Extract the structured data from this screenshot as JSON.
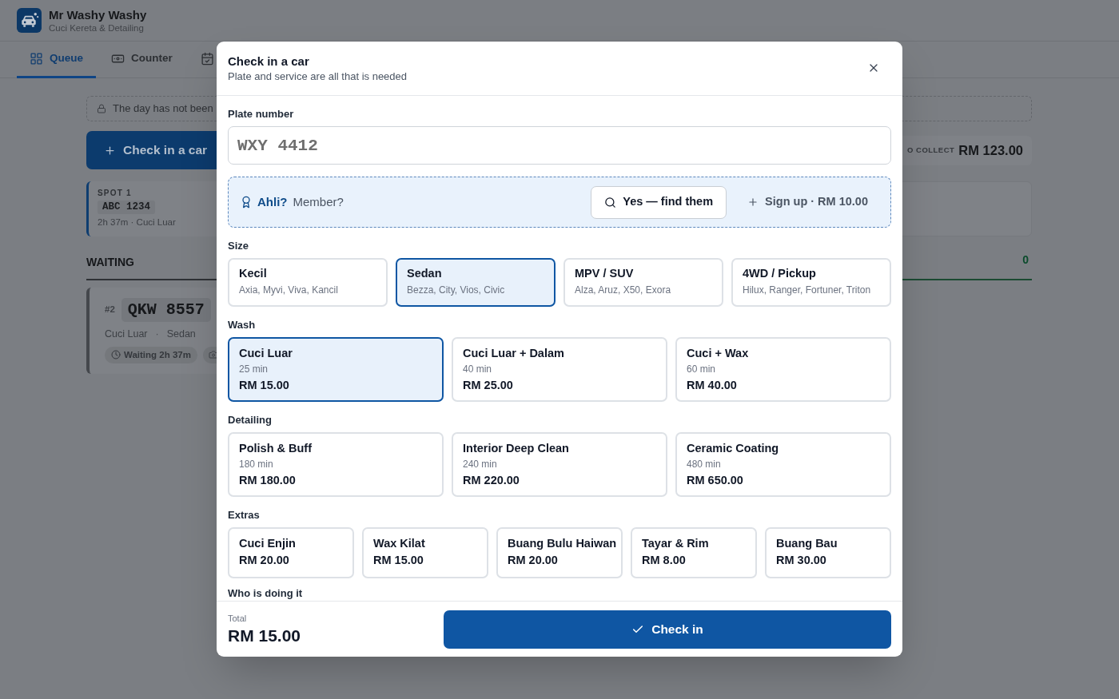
{
  "app": {
    "title": "Mr Washy Washy",
    "subtitle": "Cuci Kereta & Detailing"
  },
  "tabs": [
    {
      "kind": "grid",
      "label": "Queue",
      "selected": true
    },
    {
      "kind": "cash",
      "label": "Counter",
      "selected": false
    },
    {
      "kind": "calendar",
      "selected": false
    }
  ],
  "notice": {
    "text": "The day has not been"
  },
  "check_in_button": {
    "label": "Check in a car"
  },
  "to_collect": {
    "label": "O COLLECT",
    "amount": "RM 123.00"
  },
  "spots": [
    {
      "spot": "SPOT 1",
      "plate": "ABC 1234",
      "detail": "2h 37m · Cuci Luar"
    }
  ],
  "waiting": {
    "title": "WAITING",
    "cards": [
      {
        "number": "#2",
        "plate": "QKW 8557",
        "service": "Cuci Luar",
        "separator": "·",
        "size": "Sedan",
        "status": "Waiting 2h 37m"
      }
    ]
  },
  "column_2": {
    "count": "0"
  },
  "dialog": {
    "title": "Check in a car",
    "subtitle": "Plate and service are all that is needed",
    "plate": {
      "label": "Plate number",
      "placeholder": "WXY 4412"
    },
    "member": {
      "label": "Ahli?",
      "question": "Member?",
      "find_button": "Yes — find them",
      "signup_button": "Sign up · RM 10.00"
    },
    "sections": [
      {
        "label": "Size",
        "kind": "size",
        "options": [
          {
            "name": "Kecil",
            "detail": "Axia, Myvi, Viva, Kancil",
            "selected": false
          },
          {
            "name": "Sedan",
            "detail": "Bezza, City, Vios, Civic",
            "selected": true
          },
          {
            "name": "MPV / SUV",
            "detail": "Alza, Aruz, X50, Exora",
            "selected": false
          },
          {
            "name": "4WD / Pickup",
            "detail": "Hilux, Ranger, Fortuner, Triton",
            "selected": false
          }
        ]
      },
      {
        "label": "Wash",
        "kind": "service",
        "options": [
          {
            "name": "Cuci Luar",
            "duration": "25 min",
            "price": "RM 15.00",
            "selected": true
          },
          {
            "name": "Cuci Luar + Dalam",
            "duration": "40 min",
            "price": "RM 25.00",
            "selected": false
          },
          {
            "name": "Cuci + Wax",
            "duration": "60 min",
            "price": "RM 40.00",
            "selected": false
          }
        ]
      },
      {
        "label": "Detailing",
        "kind": "service",
        "options": [
          {
            "name": "Polish & Buff",
            "duration": "180 min",
            "price": "RM 180.00",
            "selected": false
          },
          {
            "name": "Interior Deep Clean",
            "duration": "240 min",
            "price": "RM 220.00",
            "selected": false
          },
          {
            "name": "Ceramic Coating",
            "duration": "480 min",
            "price": "RM 650.00",
            "selected": false
          }
        ]
      },
      {
        "label": "Extras",
        "kind": "extra",
        "options": [
          {
            "name": "Cuci Enjin",
            "price": "RM 20.00",
            "selected": false
          },
          {
            "name": "Wax Kilat",
            "price": "RM 15.00",
            "selected": false
          },
          {
            "name": "Buang Bulu Haiwan",
            "price": "RM 20.00",
            "selected": false
          },
          {
            "name": "Tayar & Rim",
            "price": "RM 8.00",
            "selected": false
          },
          {
            "name": "Buang Bau",
            "price": "RM 30.00",
            "selected": false
          }
        ]
      }
    ],
    "next_section": "Who is doing it",
    "total": {
      "label": "Total",
      "amount": "RM 15.00"
    },
    "submit": "Check in"
  }
}
